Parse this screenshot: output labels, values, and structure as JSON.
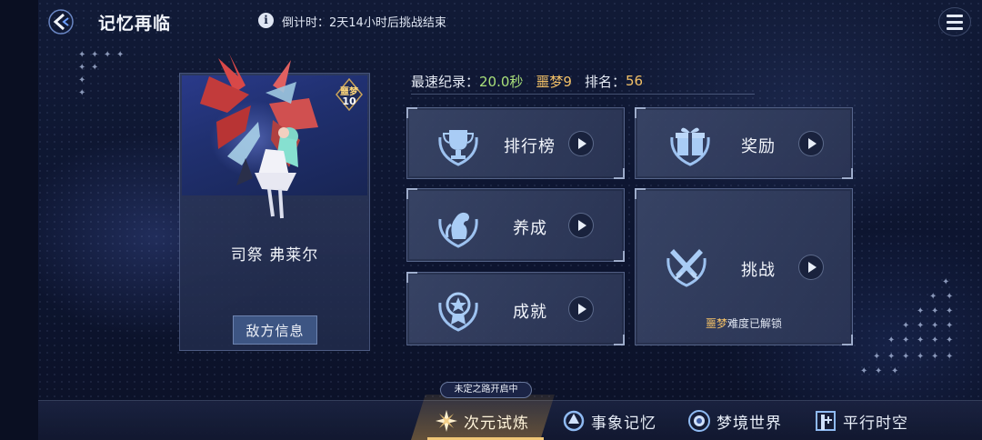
{
  "header": {
    "title": "记忆再临",
    "countdown": "倒计时：2天14小时后挑战结束"
  },
  "enemy": {
    "name": "司祭 弗莱尔",
    "difficulty_label": "噩梦",
    "difficulty_level": "10",
    "info_button": "敌方信息"
  },
  "stats": {
    "best_label": "最速纪录：",
    "best_time": "20.0秒",
    "best_difficulty": "噩梦9",
    "rank_label": "排名：",
    "rank_value": "56"
  },
  "panels": {
    "leaderboard": "排行榜",
    "rewards": "奖励",
    "training": "养成",
    "challenge": "挑战",
    "achievements": "成就",
    "nightmare_hl": "噩梦",
    "nightmare_rest": "难度已解锁"
  },
  "nav": {
    "route_pill": "未定之路开启中",
    "items": [
      "次元试炼",
      "事象记忆",
      "梦境世界",
      "平行时空"
    ]
  },
  "colors": {
    "accent_gold": "#f2c067",
    "accent_green": "#a9e07a",
    "panel_bg": "#3a4668"
  }
}
